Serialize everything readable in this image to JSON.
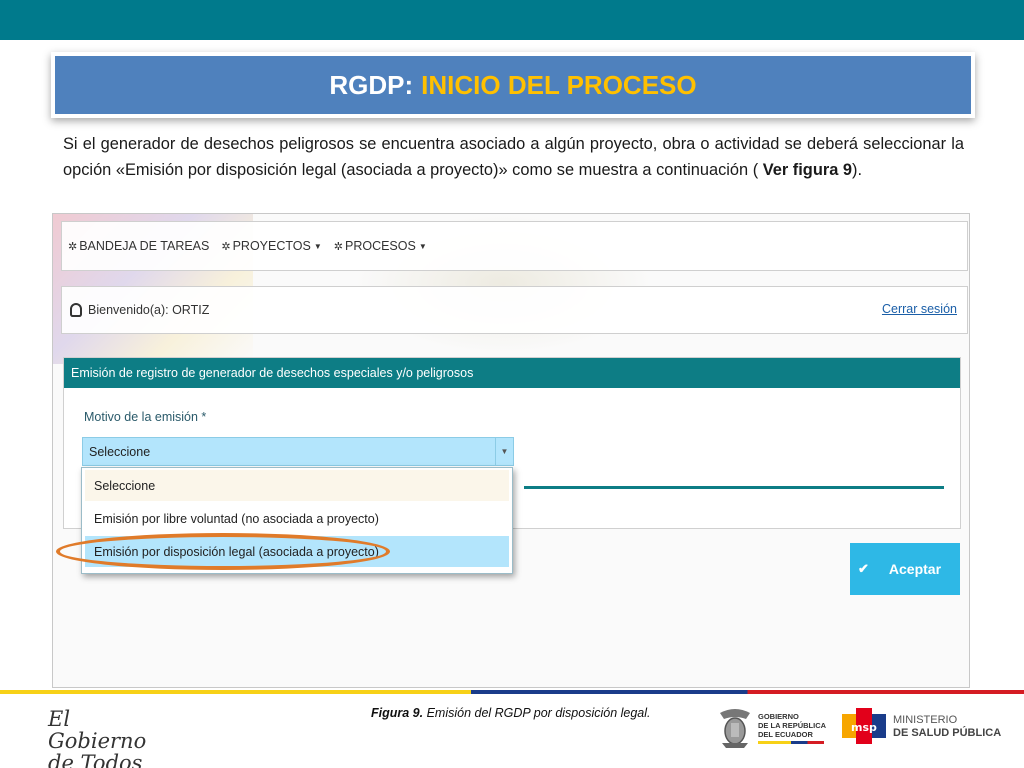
{
  "slide": {
    "title_part1": "RGDP:",
    "title_part2": "INICIO DEL PROCESO",
    "intro_text": "Si el generador de desechos peligrosos se encuentra asociado a algún proyecto, obra o actividad se deberá seleccionar la opción «Emisión por disposición legal (asociada a proyecto)» como se muestra a continuación (",
    "intro_ref": "Ver figura 9",
    "intro_end": ").",
    "caption_label": "Figura 9.",
    "caption_text": " Emisión del RGDP por disposición legal."
  },
  "app": {
    "nav": [
      {
        "label": "BANDEJA DE TAREAS",
        "icon": "gear-icon",
        "has_dropdown": false
      },
      {
        "label": "PROYECTOS",
        "icon": "gear-icon",
        "has_dropdown": true
      },
      {
        "label": "PROCESOS",
        "icon": "gear-icon",
        "has_dropdown": true
      }
    ],
    "welcome_text": "Bienvenido(a): ORTIZ",
    "logout_label": "Cerrar sesión",
    "panel_title": "Emisión de registro de generador de desechos especiales y/o peligrosos",
    "motivo_label": "Motivo de la emisión *",
    "select_value": "Seleccione",
    "dropdown_options": [
      "Seleccione",
      "Emisión por libre voluntad (no asociada a proyecto)",
      "Emisión por disposición legal (asociada a proyecto)"
    ],
    "highlighted_option_index": 2,
    "accept_label": "Aceptar"
  },
  "footer": {
    "left_logo_line1": "El Gobierno",
    "left_logo_line2": "de Todos",
    "gob_line1": "GOBIERNO",
    "gob_line2": "DE LA REPÚBLICA",
    "gob_line3": "DEL ECUADOR",
    "msp_acronym": "msp",
    "msp_line1": "MINISTERIO",
    "msp_line2": "DE SALUD PÚBLICA"
  },
  "colors": {
    "topbar": "#007a8c",
    "title_bg": "#4f81bd",
    "title_accent": "#ffc000",
    "panel_header": "#0d7d85",
    "select_bg": "#b3e5fc",
    "highlight_ring": "#e07b2a",
    "accept_button": "#2eb8e6"
  }
}
